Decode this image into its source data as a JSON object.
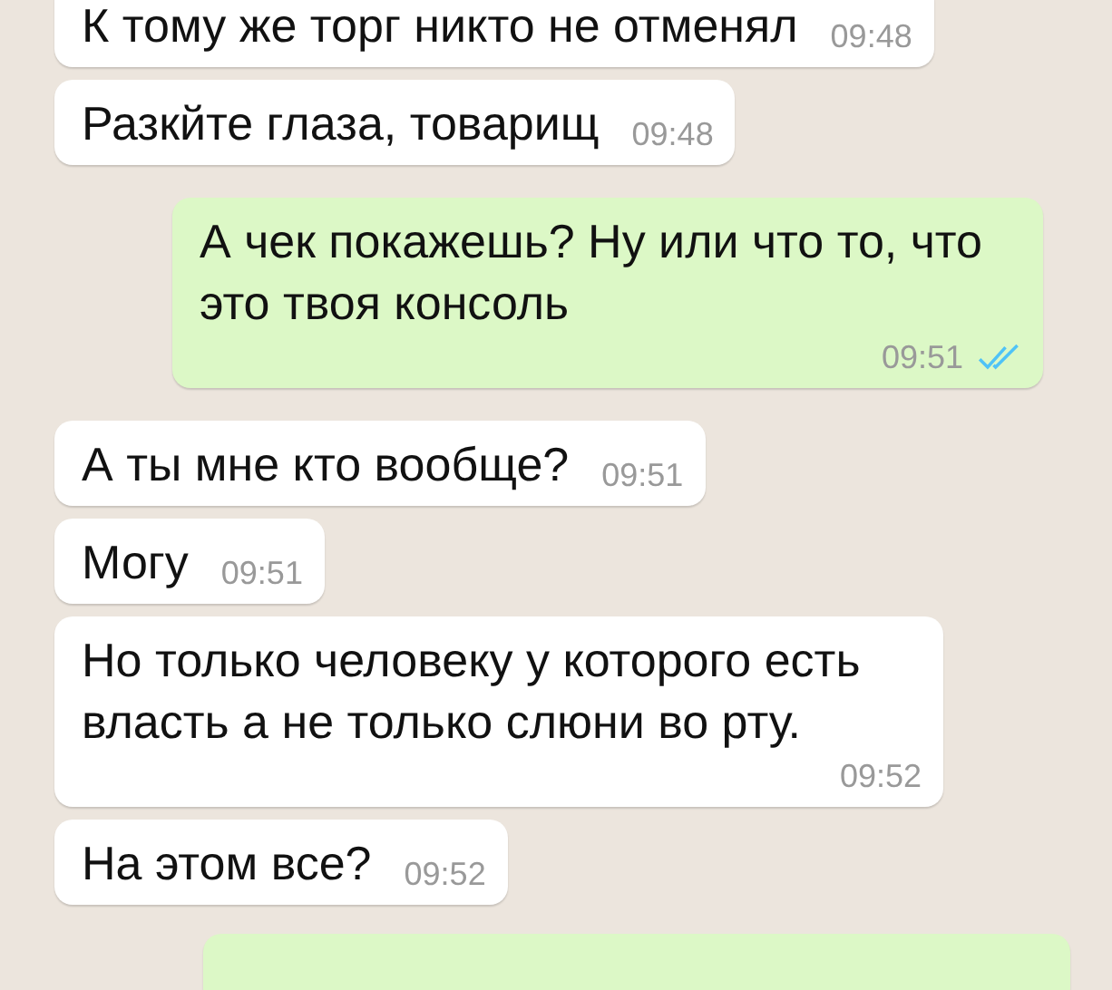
{
  "messages": [
    {
      "outgoing": false,
      "text": "К тому же торг никто не отменял",
      "time": "09:48"
    },
    {
      "outgoing": false,
      "text": "Разкйте глаза, товарищ",
      "time": "09:48"
    },
    {
      "outgoing": true,
      "text": "А чек покажешь? Ну или что то, что это твоя консоль",
      "time": "09:51",
      "read": true
    },
    {
      "outgoing": false,
      "text": "А ты мне кто вообще?",
      "time": "09:51"
    },
    {
      "outgoing": false,
      "text": "Могу",
      "time": "09:51"
    },
    {
      "outgoing": false,
      "text": "Но только человеку у которого есть власть а не только слюни во рту.",
      "time": "09:52"
    },
    {
      "outgoing": false,
      "text": "На этом все?",
      "time": "09:52"
    }
  ]
}
